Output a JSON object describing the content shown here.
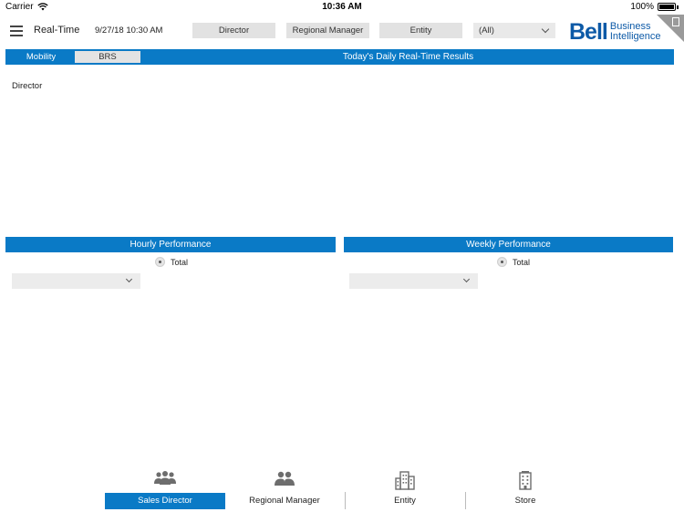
{
  "status_bar": {
    "carrier": "Carrier",
    "time": "10:36 AM",
    "battery": "100%"
  },
  "header": {
    "title": "Real-Time",
    "timestamp": "9/27/18 10:30 AM",
    "filters": [
      "Director",
      "Regional Manager",
      "Entity"
    ],
    "selected_value": "(All)",
    "logo_word": "Bell",
    "logo_line1": "Business",
    "logo_line2": "Intelligence"
  },
  "main_bar": {
    "tabs": [
      "Mobility",
      "BRS"
    ],
    "title": "Today's Daily Real-Time Results"
  },
  "content": {
    "director_label": "Director"
  },
  "panels": [
    {
      "title": "Hourly Performance",
      "radio_label": "Total"
    },
    {
      "title": "Weekly Performance",
      "radio_label": "Total"
    }
  ],
  "bottom_nav": {
    "items": [
      {
        "label": "Sales Director",
        "icon": "group-icon",
        "active": true
      },
      {
        "label": "Regional Manager",
        "icon": "people-icon",
        "active": false
      },
      {
        "label": "Entity",
        "icon": "building-icon",
        "active": false
      },
      {
        "label": "Store",
        "icon": "store-building-icon",
        "active": false
      }
    ]
  },
  "colors": {
    "accent_blue": "#0a7ac6",
    "logo_blue": "#0d5aa7"
  }
}
